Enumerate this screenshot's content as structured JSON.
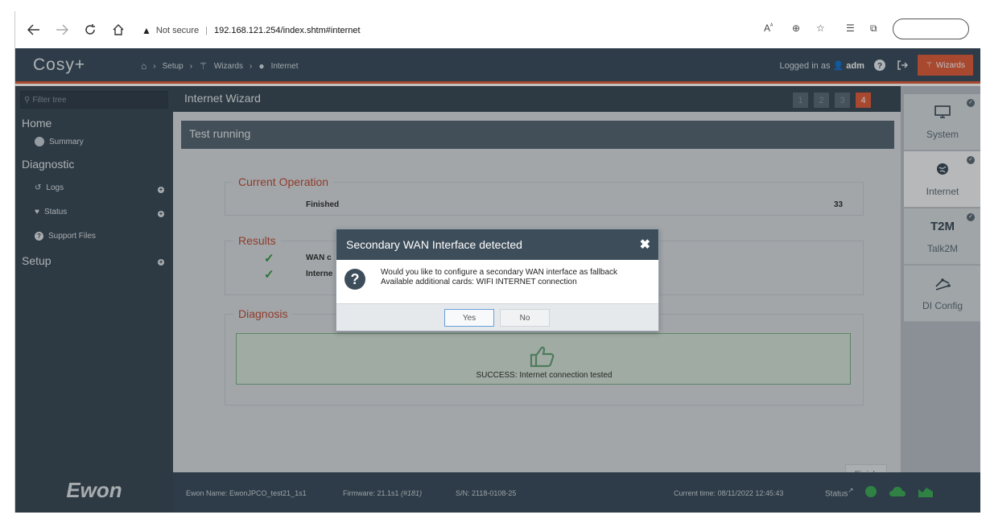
{
  "browser": {
    "warning": "Not secure",
    "url": "192.168.121.254/index.shtm#internet"
  },
  "header": {
    "logo": "Cosy+",
    "breadcrumb": [
      "Setup",
      "Wizards",
      "Internet"
    ],
    "logged_in_prefix": "Logged in as",
    "user": "adm",
    "wizards_label": "Wizards"
  },
  "sidebar": {
    "filter_placeholder": "Filter tree",
    "home_label": "Home",
    "summary_label": "Summary",
    "diagnostic_label": "Diagnostic",
    "logs_label": "Logs",
    "status_label": "Status",
    "support_files_label": "Support Files",
    "setup_label": "Setup"
  },
  "wizard": {
    "title": "Internet Wizard",
    "steps": [
      "1",
      "2",
      "3",
      "4"
    ],
    "active_step": 4,
    "test_running": "Test running",
    "current_operation_legend": "Current Operation",
    "current_operation_value": "Finished",
    "current_operation_count": "33",
    "results_legend": "Results",
    "result_1": "WAN c",
    "result_2": "Interne",
    "diagnosis_legend": "Diagnosis",
    "success_text": "SUCCESS: Internet connection tested",
    "finish_label": "Finish"
  },
  "right_tabs": [
    {
      "label": "System",
      "icon": "monitor-icon"
    },
    {
      "label": "Internet",
      "icon": "globe-icon"
    },
    {
      "label": "Talk2M",
      "icon": "t2m-logo"
    },
    {
      "label": "DI Config",
      "icon": "di-config-icon"
    }
  ],
  "right_tab_t2m_text": "T2M",
  "footer": {
    "logo": "Ewon",
    "ewon_name": "Ewon Name: EwonJPCO_test21_1s1",
    "firmware_prefix": "Firmware: 21.1s1",
    "firmware_build": "(#181)",
    "serial": "S/N: 2118-0108-25",
    "current_time": "Current time: 08/11/2022 12:45:43",
    "status_label": "Status"
  },
  "dialog": {
    "title": "Secondary WAN Interface detected",
    "line1": "Would you like to configure a secondary WAN interface as fallback",
    "line2": "Available additional cards: WIFI INTERNET connection",
    "yes_label": "Yes",
    "no_label": "No"
  },
  "colors": {
    "accent": "#e0603f",
    "header_bg": "#3d5060",
    "success_green": "#3a9a48"
  }
}
